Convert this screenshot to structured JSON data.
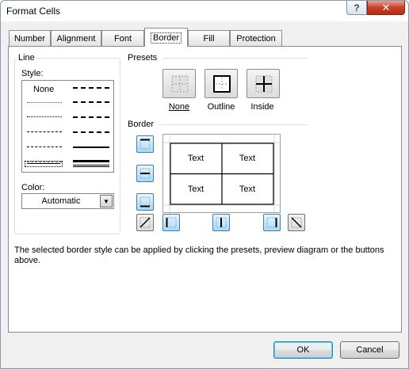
{
  "window": {
    "title": "Format Cells",
    "help_glyph": "?",
    "close_glyph": "✕"
  },
  "tabs": [
    {
      "label": "Number"
    },
    {
      "label": "Alignment"
    },
    {
      "label": "Font"
    },
    {
      "label": "Border",
      "active": true
    },
    {
      "label": "Fill"
    },
    {
      "label": "Protection"
    }
  ],
  "line_group": {
    "label": "Line",
    "style_label": "Style:",
    "style_none": "None",
    "color_label": "Color:",
    "color_value": "Automatic"
  },
  "presets": {
    "label": "Presets",
    "none": "None",
    "outline": "Outline",
    "inside": "Inside"
  },
  "border": {
    "label": "Border",
    "preview_cells": [
      "Text",
      "Text",
      "Text",
      "Text"
    ]
  },
  "description": "The selected border style can be applied by clicking the presets, preview diagram or the buttons above.",
  "buttons": {
    "ok": "OK",
    "cancel": "Cancel"
  },
  "colors": {
    "accent": "#3c7fb1",
    "close": "#c7412a"
  }
}
